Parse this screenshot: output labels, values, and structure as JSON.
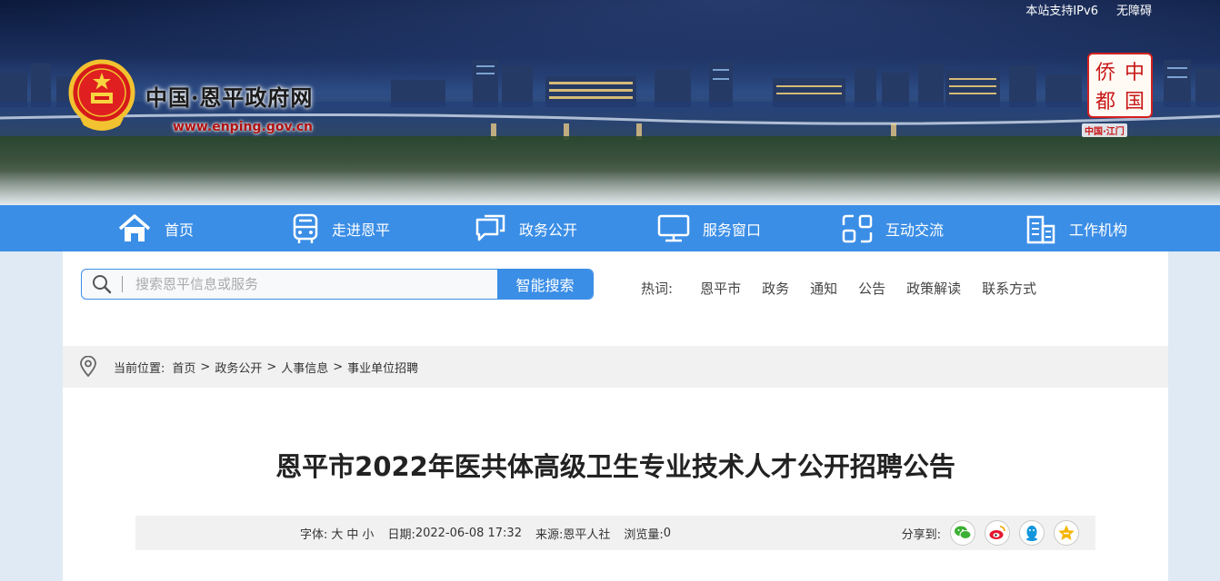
{
  "top_links": [
    "本站支持IPv6",
    "无障碍"
  ],
  "site": {
    "title": "中国·恩平政府网",
    "url": "www.enping.gov.cn"
  },
  "qiaodu": {
    "chars": [
      "侨",
      "中",
      "都",
      "国"
    ],
    "caption": "中国·江门"
  },
  "nav": [
    {
      "label": "首页",
      "icon": "home-icon"
    },
    {
      "label": "走进恩平",
      "icon": "bus-icon"
    },
    {
      "label": "政务公开",
      "icon": "chat-icon"
    },
    {
      "label": "服务窗口",
      "icon": "monitor-icon"
    },
    {
      "label": "互动交流",
      "icon": "interaction-icon"
    },
    {
      "label": "工作机构",
      "icon": "building-icon"
    }
  ],
  "search": {
    "placeholder": "搜索恩平信息或服务",
    "button": "智能搜索"
  },
  "hotwords": {
    "label": "热词:",
    "items": [
      "恩平市",
      "政务",
      "通知",
      "公告",
      "政策解读",
      "联系方式"
    ]
  },
  "breadcrumb": {
    "label": "当前位置:",
    "items": [
      "首页",
      "政务公开",
      "人事信息",
      "事业单位招聘"
    ],
    "separator": ">"
  },
  "article": {
    "title": "恩平市2022年医共体高级卫生专业技术人才公开招聘公告"
  },
  "meta": {
    "font_label": "字体:",
    "font_sizes": [
      "大",
      "中",
      "小"
    ],
    "date_label": "日期:",
    "date": "2022-06-08 17:32",
    "source_label": "来源:",
    "source": "恩平人社",
    "views_label": "浏览量:",
    "views": "0",
    "share_label": "分享到:",
    "share_targets": [
      "wechat-icon",
      "weibo-icon",
      "qq-icon",
      "qzone-icon"
    ]
  },
  "colors": {
    "nav_bg": "#3b8ee6",
    "accent": "#3b8ee6",
    "url_red": "#b01010",
    "wechat": "#3cb034",
    "weibo": "#e6162d",
    "qq": "#1296db",
    "qzone": "#f5b400"
  }
}
